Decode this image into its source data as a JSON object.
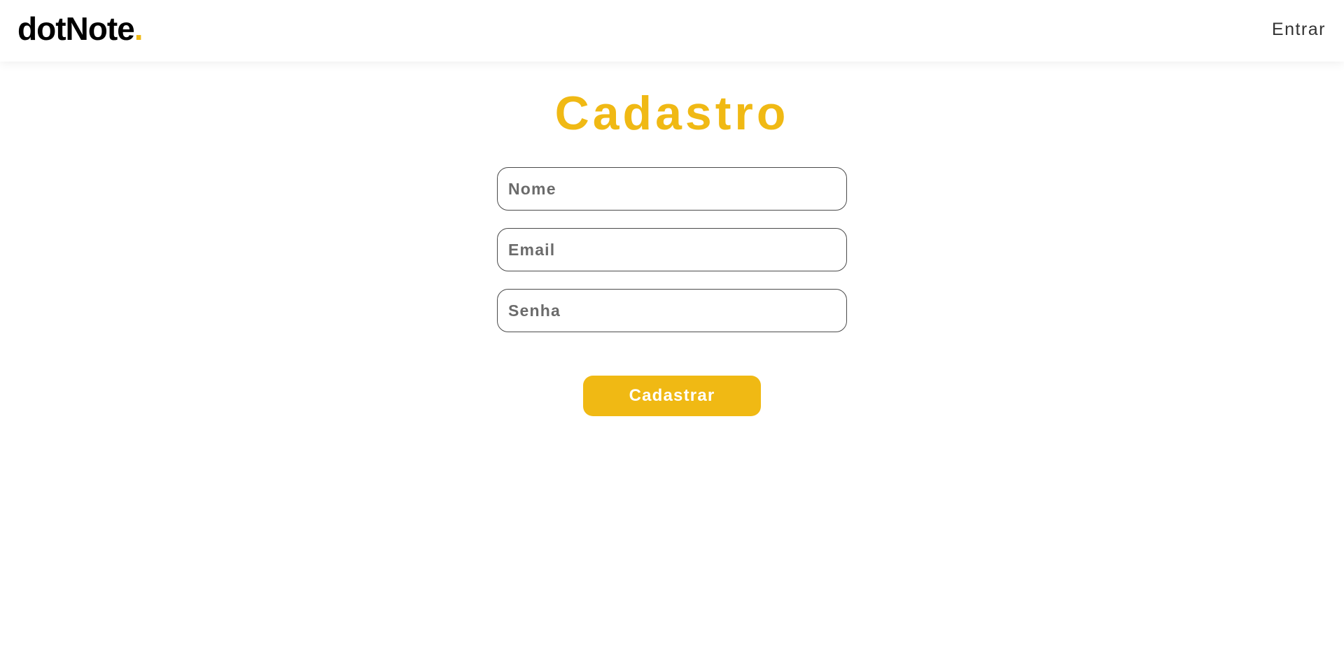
{
  "header": {
    "logo_text": "dotNote",
    "logo_dot": ".",
    "login_link": "Entrar"
  },
  "main": {
    "title": "Cadastro",
    "form": {
      "name_placeholder": "Nome",
      "email_placeholder": "Email",
      "password_placeholder": "Senha",
      "submit_label": "Cadastrar"
    }
  },
  "colors": {
    "accent": "#f0b914",
    "text_dark": "#000000",
    "border": "#4a4a4a",
    "background": "#ffffff"
  }
}
